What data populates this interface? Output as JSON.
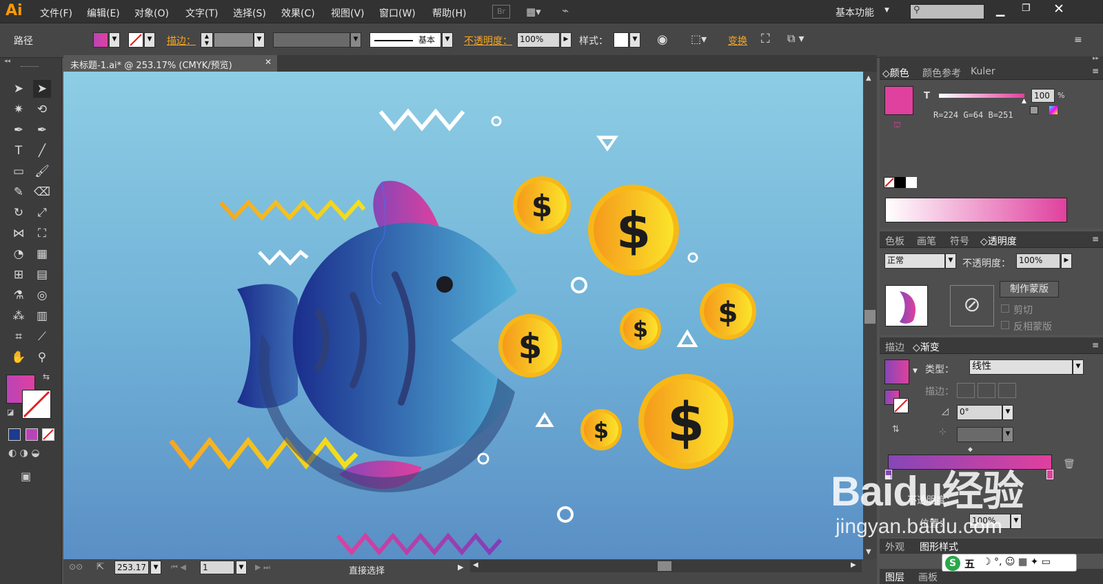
{
  "app": {
    "logo": "Ai"
  },
  "menu": [
    "文件(F)",
    "编辑(E)",
    "对象(O)",
    "文字(T)",
    "选择(S)",
    "效果(C)",
    "视图(V)",
    "窗口(W)",
    "帮助(H)"
  ],
  "br_badge": "Br",
  "workspace": "基本功能",
  "control": {
    "path_label": "路径",
    "stroke_label": "描边：",
    "stroke_style": "基本",
    "opacity_label": "不透明度：",
    "opacity_value": "100%",
    "style_label": "样式：",
    "transform_label": "变换"
  },
  "doc_tab": {
    "title": "未标题-1.ai* @ 253.17% (CMYK/预览)"
  },
  "status": {
    "zoom": "253.17",
    "page": "1",
    "tool": "直接选择"
  },
  "color_panel": {
    "tabs": [
      "颜色",
      "颜色参考",
      "Kuler"
    ],
    "channel": "T",
    "tint": "100",
    "pct": "%",
    "rgb": "R=224 G=64 B=251",
    "fill_color": "#e0409e"
  },
  "transparency_panel": {
    "tabs": [
      "色板",
      "画笔",
      "符号",
      "透明度"
    ],
    "mode": "正常",
    "opacity_label": "不透明度：",
    "opacity": "100%",
    "make_mask": "制作蒙版",
    "clip": "剪切",
    "invert": "反相蒙版"
  },
  "gradient_panel": {
    "tabs": [
      "描边",
      "渐变"
    ],
    "type_label": "类型：",
    "type": "线性",
    "stroke_label": "描边：",
    "angle": "0°",
    "position_label": "位置：",
    "position": "100%",
    "opacity_label": "不透明度："
  },
  "bottom_tabs": {
    "appearance": [
      "外观",
      "图形样式"
    ],
    "layers": [
      "图层",
      "画板"
    ]
  },
  "watermark": {
    "brand": "Baidu经验",
    "url": "jingyan.baidu.com"
  },
  "ime": {
    "label": "五"
  },
  "artwork": {
    "coin_symbol": "$"
  },
  "colors": {
    "accent": "#f5a623",
    "fill": "#e0409e",
    "bg": "#535353"
  }
}
